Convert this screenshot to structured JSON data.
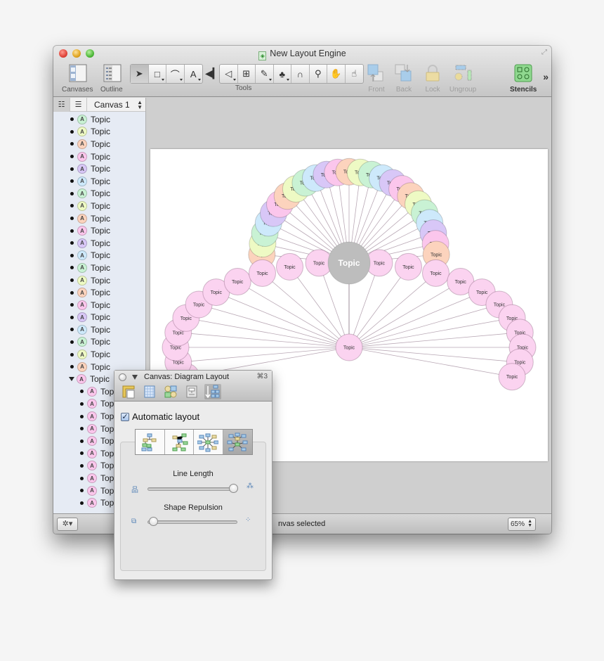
{
  "window": {
    "title": "New Layout Engine",
    "document_icon": "document-icon"
  },
  "toolbar": {
    "canvases_label": "Canvases",
    "outline_label": "Outline",
    "tools_label": "Tools",
    "front_label": "Front",
    "back_label": "Back",
    "lock_label": "Lock",
    "ungroup_label": "Ungroup",
    "stencils_label": "Stencils",
    "overflow_label": "»",
    "tools": [
      {
        "icon": "selection-arrow-icon",
        "glyph": "➤",
        "active": true
      },
      {
        "icon": "shape-tool-icon",
        "glyph": "□",
        "dropdown": true
      },
      {
        "icon": "line-tool-icon",
        "glyph": "⌒",
        "dropdown": true
      },
      {
        "icon": "text-tool-icon",
        "glyph": "A",
        "dropdown": true
      },
      {
        "icon": "point-editor-icon",
        "glyph": "◁",
        "dropdown": true
      },
      {
        "icon": "diagram-tool-icon",
        "glyph": "⊞"
      },
      {
        "icon": "style-brush-icon",
        "glyph": "✎",
        "dropdown": true
      },
      {
        "icon": "rubber-stamp-icon",
        "glyph": "♣",
        "dropdown": true
      },
      {
        "icon": "magnet-icon",
        "glyph": "∩"
      },
      {
        "icon": "zoom-tool-icon",
        "glyph": "⚲"
      },
      {
        "icon": "hand-tool-icon",
        "glyph": "✋"
      },
      {
        "icon": "browse-tool-icon",
        "glyph": "☝"
      }
    ]
  },
  "sidebar": {
    "canvas_selector": "Canvas 1",
    "badge_letter": "A",
    "items": [
      {
        "label": "Topic",
        "color": "#c9f2d4"
      },
      {
        "label": "Topic",
        "color": "#eefac4"
      },
      {
        "label": "Topic",
        "color": "#fcd3bd"
      },
      {
        "label": "Topic",
        "color": "#fbc6ec"
      },
      {
        "label": "Topic",
        "color": "#d8c7f7"
      },
      {
        "label": "Topic",
        "color": "#cde9fb"
      },
      {
        "label": "Topic",
        "color": "#c9f2d4"
      },
      {
        "label": "Topic",
        "color": "#eefac4"
      },
      {
        "label": "Topic",
        "color": "#fcd3bd"
      },
      {
        "label": "Topic",
        "color": "#fbc6ec"
      },
      {
        "label": "Topic",
        "color": "#d8c7f7"
      },
      {
        "label": "Topic",
        "color": "#cde9fb"
      },
      {
        "label": "Topic",
        "color": "#c9f2d4"
      },
      {
        "label": "Topic",
        "color": "#eefac4"
      },
      {
        "label": "Topic",
        "color": "#fcd3bd"
      },
      {
        "label": "Topic",
        "color": "#fbc6ec"
      },
      {
        "label": "Topic",
        "color": "#d8c7f7"
      },
      {
        "label": "Topic",
        "color": "#cde9fb"
      },
      {
        "label": "Topic",
        "color": "#c9f2d4"
      },
      {
        "label": "Topic",
        "color": "#eefac4"
      },
      {
        "label": "Topic",
        "color": "#fcd3bd"
      },
      {
        "label": "Topic",
        "color": "#fbc6ec",
        "expanded": true
      },
      {
        "label": "Topi",
        "color": "#fbc6ec",
        "child": true
      },
      {
        "label": "Topi",
        "color": "#fbc6ec",
        "child": true
      },
      {
        "label": "Topi",
        "color": "#fbc6ec",
        "child": true
      },
      {
        "label": "Topi",
        "color": "#fbc6ec",
        "child": true
      },
      {
        "label": "Topi",
        "color": "#fbc6ec",
        "child": true
      },
      {
        "label": "Topi",
        "color": "#fbc6ec",
        "child": true
      },
      {
        "label": "Topi",
        "color": "#fbc6ec",
        "child": true
      },
      {
        "label": "Topi",
        "color": "#fbc6ec",
        "child": true
      },
      {
        "label": "Topi",
        "color": "#fbc6ec",
        "child": true
      },
      {
        "label": "Topi",
        "color": "#fbc6ec",
        "child": true
      }
    ]
  },
  "diagram": {
    "root_label": "Topic",
    "root_color": "#bdbdbd",
    "hub_label": "Topic",
    "hub_color": "#fbd3f0",
    "arc_node_label": "Topic",
    "arc_colors": [
      "#fcd3bd",
      "#eefac4",
      "#c9f2d4",
      "#cde9fb",
      "#d8c7f7",
      "#fbc6ec"
    ],
    "arc_node_count": 25,
    "fan_node_label": "Topic",
    "fan_node_count": 23,
    "line_color": "#b9a8b5"
  },
  "statusbar": {
    "status_text": "nvas selected",
    "zoom_value": "65%"
  },
  "inspector": {
    "title": "Canvas: Diagram Layout",
    "shortcut": "⌘3",
    "automatic_layout_label": "Automatic layout",
    "automatic_layout_checked": true,
    "layout_modes": [
      "hierarchical-top-down",
      "hierarchical-mixed",
      "force-directed",
      "radial"
    ],
    "active_mode": 3,
    "line_length_label": "Line Length",
    "line_length_value": 1.0,
    "shape_repulsion_label": "Shape Repulsion",
    "shape_repulsion_value": 0.0
  }
}
